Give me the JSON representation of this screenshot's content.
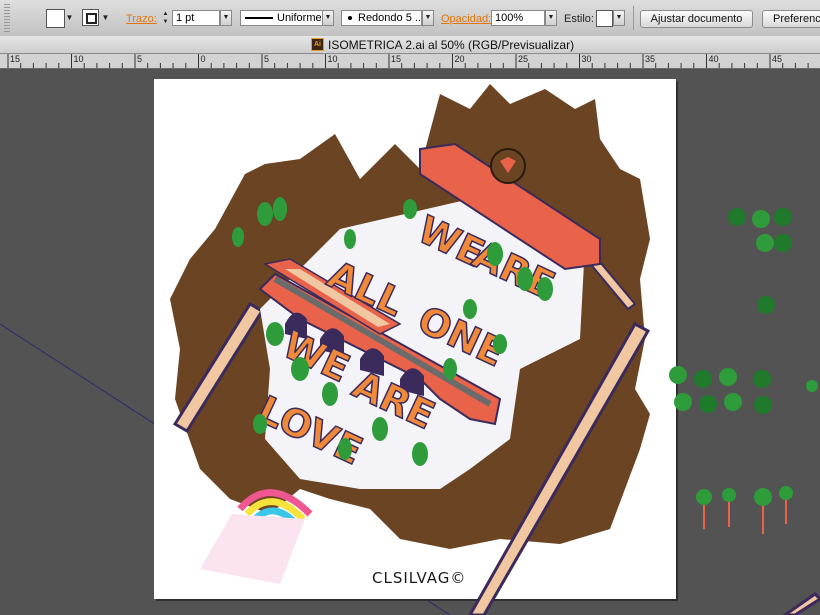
{
  "control_bar": {
    "stroke_label": "Trazo:",
    "stroke_weight": "1 pt",
    "stroke_profile": "Uniforme",
    "brush": "Redondo 5 ...",
    "opacity_label": "Opacidad:",
    "opacity_value": "100%",
    "style_label": "Estilo:",
    "document_setup_button": "Ajustar documento",
    "preferences_button": "Preferencias"
  },
  "document": {
    "tab_title": "ISOMETRICA 2.ai al 50% (RGB/Previsualizar)",
    "file_icon": "Ai"
  },
  "ruler": {
    "labels": [
      "15",
      "10",
      "5",
      "0",
      "5",
      "10",
      "15",
      "20",
      "25",
      "30",
      "35",
      "40",
      "45"
    ]
  },
  "artwork": {
    "signature": "CLSILVAG©",
    "colors": {
      "mountain": "#6b4423",
      "brick": "#e8634a",
      "dark_brick": "#3b2a5c",
      "tree": "#2e9c3a",
      "leaf": "#1f7a2b",
      "rainbow_pink": "#f0568f",
      "rainbow_yellow": "#f5e23a",
      "rainbow_cyan": "#3bc6e8"
    }
  }
}
